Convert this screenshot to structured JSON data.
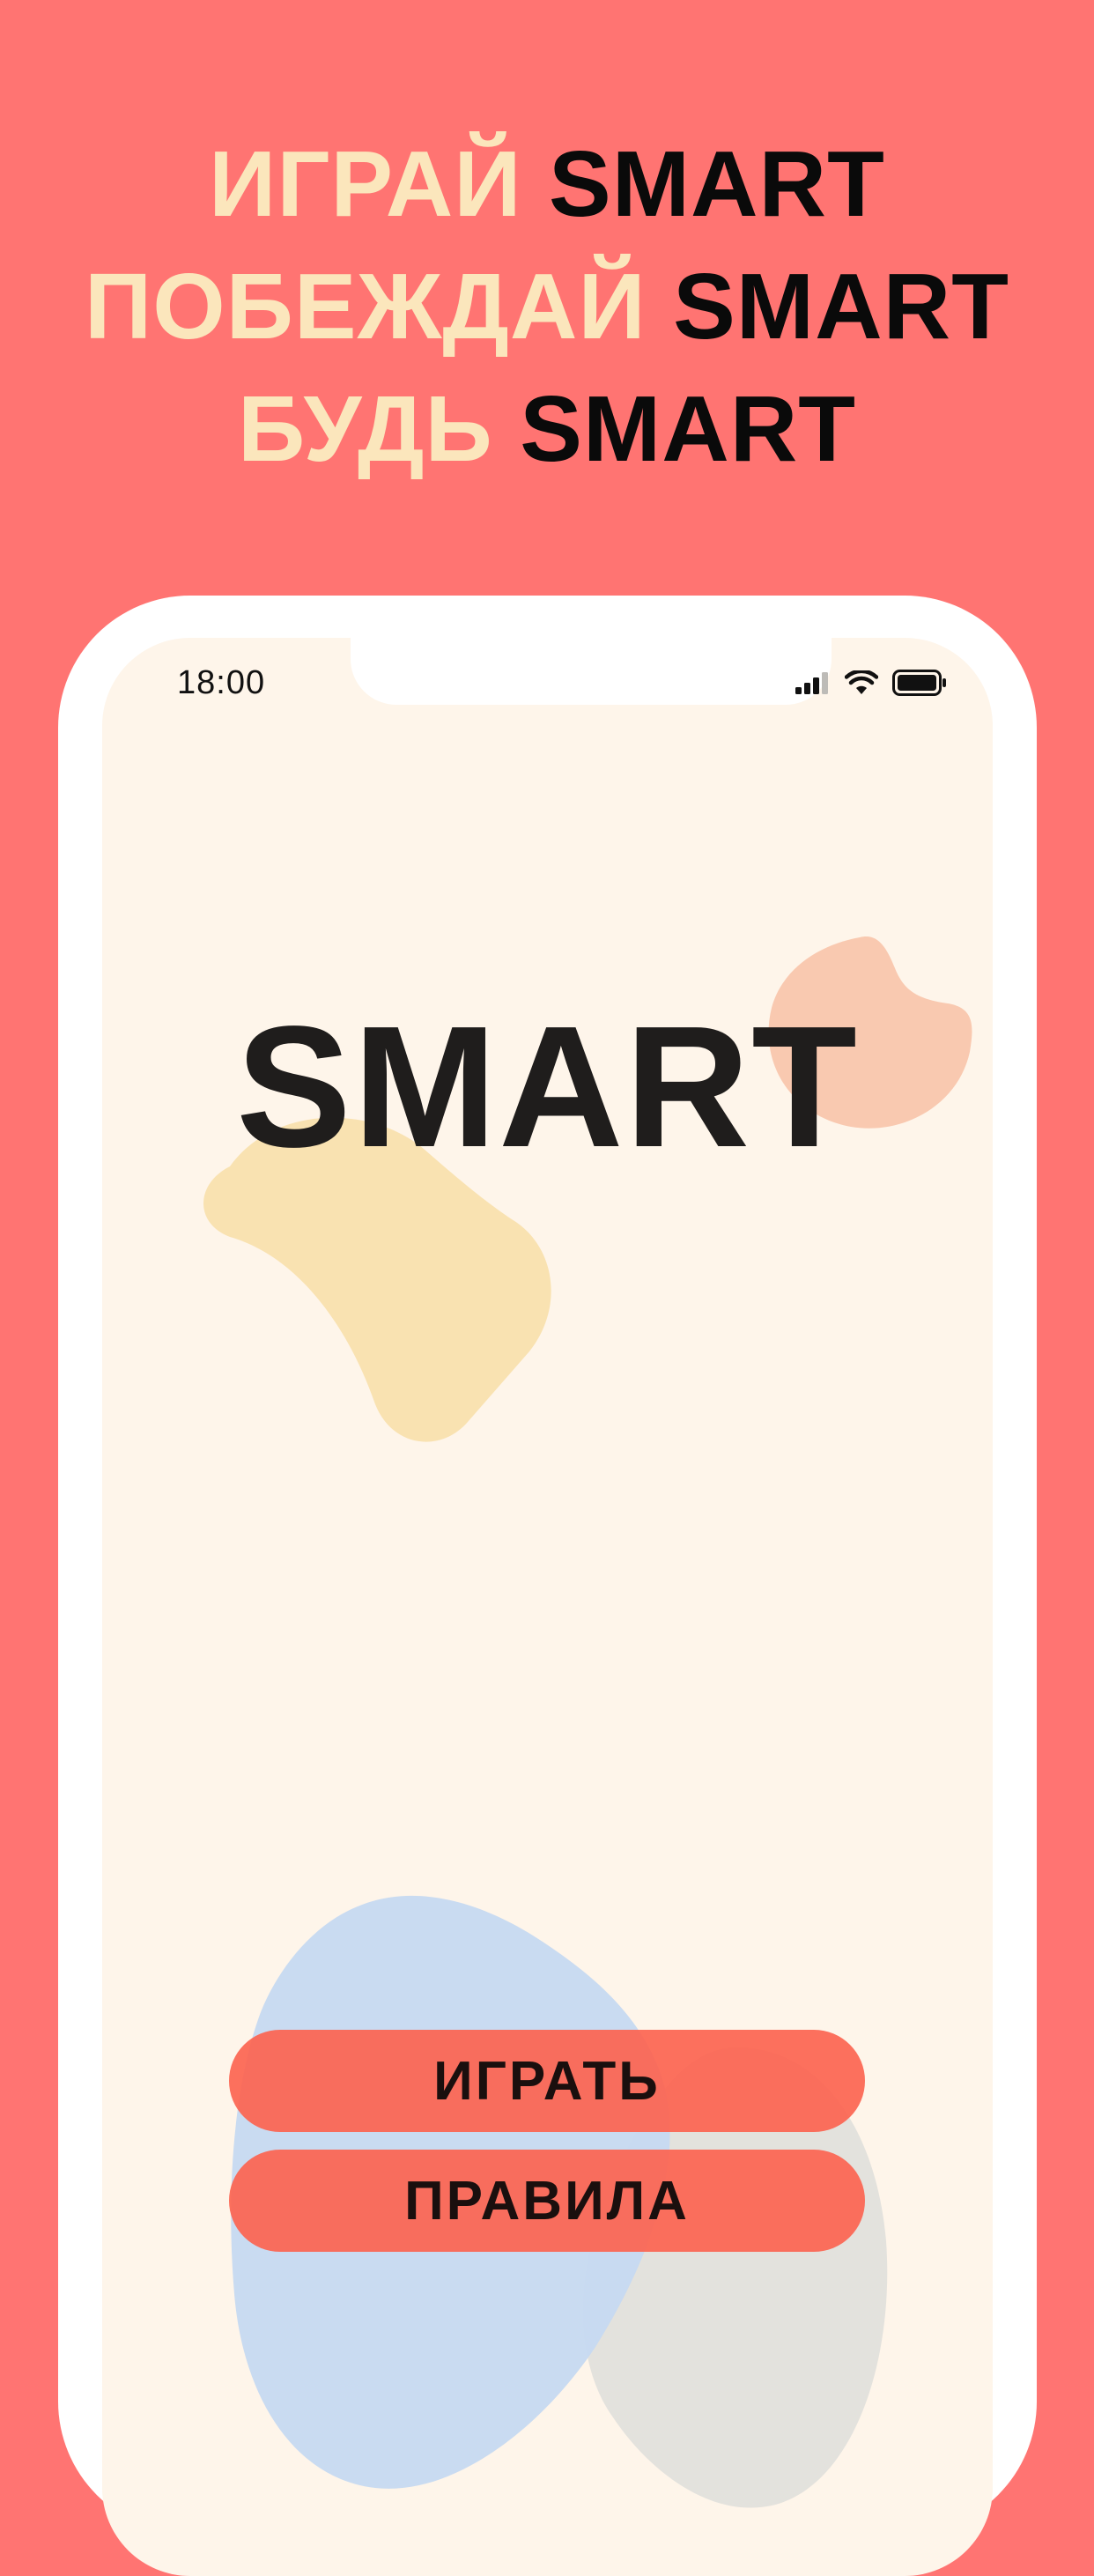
{
  "headline": {
    "line1": {
      "accent": "ИГРАЙ",
      "word": "SMART"
    },
    "line2": {
      "accent": "ПОБЕЖДАЙ",
      "word": "SMART"
    },
    "line3": {
      "accent": "БУДЬ",
      "word": "SMART"
    }
  },
  "status_bar": {
    "time": "18:00",
    "icons": [
      "cellular-signal-icon",
      "wifi-icon",
      "battery-icon"
    ]
  },
  "app": {
    "logo": "SMART",
    "buttons": {
      "play": "ИГРАТЬ",
      "rules": "ПРАВИЛА"
    }
  },
  "colors": {
    "background": "#FF7472",
    "headline_accent": "#FBE6BC",
    "headline_dark": "#0A0A0A",
    "screen": "#FEF5EA",
    "button": "#FC6450",
    "blob_yellow": "#F9E2B1",
    "blob_peach": "#F9C9B0",
    "blob_blue": "#C6D9F1",
    "blob_gray": "#E2E0DC"
  }
}
